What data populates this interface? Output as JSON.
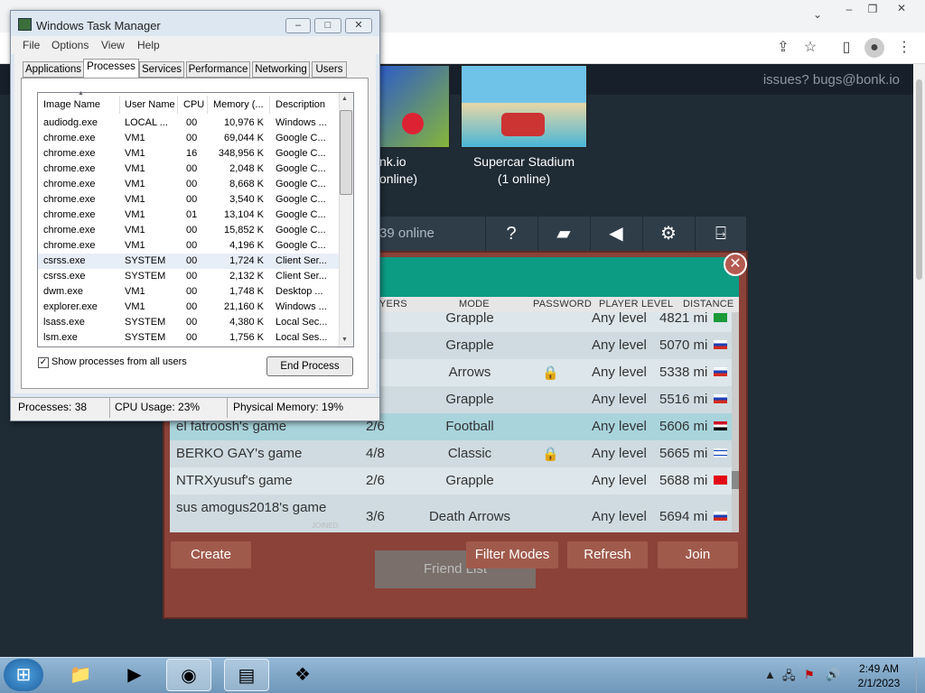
{
  "browser": {
    "issues_text": "issues? bugs@bonk.io"
  },
  "lobby": {
    "thumbs": [
      {
        "name": "nk.io",
        "online": "online)"
      },
      {
        "name": "Supercar Stadium",
        "online": "(1 online)"
      }
    ],
    "online_count": "39 online",
    "columns": [
      "YERS",
      "MODE",
      "PASSWORD",
      "PLAYER LEVEL",
      "DISTANCE"
    ],
    "rows": [
      {
        "name": "",
        "players": "/6",
        "mode": "Grapple",
        "locked": false,
        "level": "Any level",
        "distance": "4821 mi",
        "flag": "brazil"
      },
      {
        "name": "",
        "players": "/6",
        "mode": "Grapple",
        "locked": false,
        "level": "Any level",
        "distance": "5070 mi",
        "flag": "russia"
      },
      {
        "name": "",
        "players": "/6",
        "mode": "Arrows",
        "locked": true,
        "level": "Any level",
        "distance": "5338 mi",
        "flag": "russia"
      },
      {
        "name": "",
        "players": "/6",
        "mode": "Grapple",
        "locked": false,
        "level": "Any level",
        "distance": "5516 mi",
        "flag": "russia"
      },
      {
        "name": "el fatroosh's game",
        "players": "2/6",
        "mode": "Football",
        "locked": false,
        "level": "Any level",
        "distance": "5606 mi",
        "flag": "egypt"
      },
      {
        "name": "BERKO GAY's game",
        "players": "4/8",
        "mode": "Classic",
        "locked": true,
        "level": "Any level",
        "distance": "5665 mi",
        "flag": "israel"
      },
      {
        "name": "NTRXyusuf's game",
        "players": "2/6",
        "mode": "Grapple",
        "locked": false,
        "level": "Any level",
        "distance": "5688 mi",
        "flag": "turkey"
      },
      {
        "name": "sus amogus2018's game",
        "players": "3/6",
        "mode": "Death Arrows",
        "locked": false,
        "level": "Any level",
        "distance": "5694 mi",
        "flag": "russia"
      }
    ],
    "joined_label": "JOINED",
    "buttons": {
      "create": "Create",
      "filter": "Filter Modes",
      "refresh": "Refresh",
      "join": "Join",
      "friend_list": "Friend List"
    },
    "close": "✕"
  },
  "taskmgr": {
    "title": "Windows Task Manager",
    "menu": [
      "File",
      "Options",
      "View",
      "Help"
    ],
    "tabs": [
      "Applications",
      "Processes",
      "Services",
      "Performance",
      "Networking",
      "Users"
    ],
    "columns": [
      "Image Name",
      "User Name",
      "CPU",
      "Memory (...",
      "Description"
    ],
    "processes": [
      [
        "audiodg.exe",
        "LOCAL ...",
        "00",
        "10,976 K",
        "Windows ..."
      ],
      [
        "chrome.exe",
        "VM1",
        "00",
        "69,044 K",
        "Google C..."
      ],
      [
        "chrome.exe",
        "VM1",
        "16",
        "348,956 K",
        "Google C..."
      ],
      [
        "chrome.exe",
        "VM1",
        "00",
        "2,048 K",
        "Google C..."
      ],
      [
        "chrome.exe",
        "VM1",
        "00",
        "8,668 K",
        "Google C..."
      ],
      [
        "chrome.exe",
        "VM1",
        "00",
        "3,540 K",
        "Google C..."
      ],
      [
        "chrome.exe",
        "VM1",
        "01",
        "13,104 K",
        "Google C..."
      ],
      [
        "chrome.exe",
        "VM1",
        "00",
        "15,852 K",
        "Google C..."
      ],
      [
        "chrome.exe",
        "VM1",
        "00",
        "4,196 K",
        "Google C..."
      ],
      [
        "csrss.exe",
        "SYSTEM",
        "00",
        "1,724 K",
        "Client Ser..."
      ],
      [
        "csrss.exe",
        "SYSTEM",
        "00",
        "2,132 K",
        "Client Ser..."
      ],
      [
        "dwm.exe",
        "VM1",
        "00",
        "1,748 K",
        "Desktop ..."
      ],
      [
        "explorer.exe",
        "VM1",
        "00",
        "21,160 K",
        "Windows ..."
      ],
      [
        "lsass.exe",
        "SYSTEM",
        "00",
        "4,380 K",
        "Local Sec..."
      ],
      [
        "lsm.exe",
        "SYSTEM",
        "00",
        "1,756 K",
        "Local Ses..."
      ]
    ],
    "selected_index": 9,
    "show_all_label": "Show processes from all users",
    "end_process": "End Process",
    "status": {
      "processes": "Processes: 38",
      "cpu": "CPU Usage: 23%",
      "memory": "Physical Memory: 19%"
    }
  },
  "clock": {
    "time": "2:49 AM",
    "date": "2/1/2023"
  },
  "colors": {
    "teal": "#0c9b83",
    "brown": "#8b4239",
    "button": "#a05a4c"
  }
}
